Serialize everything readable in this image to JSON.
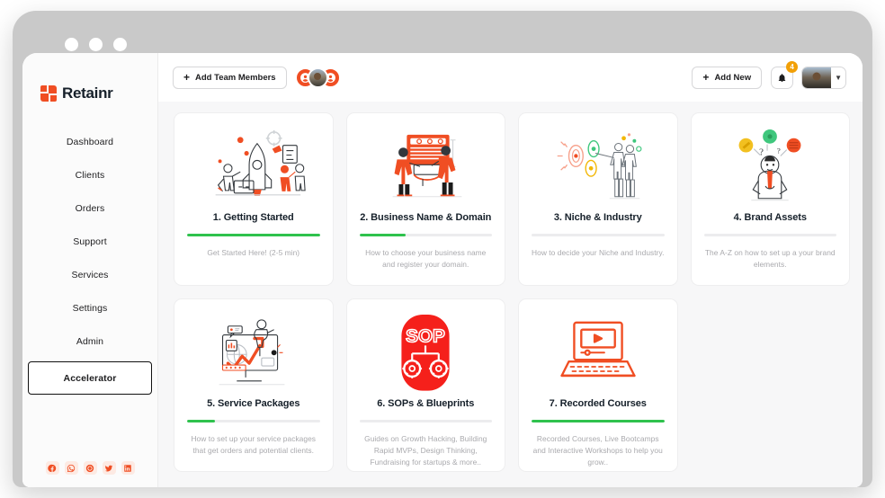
{
  "window": {
    "dots": [
      "close",
      "minimize",
      "maximize"
    ]
  },
  "sidebar": {
    "brand": "Retainr",
    "items": [
      {
        "label": "Dashboard",
        "active": false
      },
      {
        "label": "Clients",
        "active": false
      },
      {
        "label": "Orders",
        "active": false
      },
      {
        "label": "Support",
        "active": false
      },
      {
        "label": "Services",
        "active": false
      },
      {
        "label": "Settings",
        "active": false
      },
      {
        "label": "Admin",
        "active": false
      },
      {
        "label": "Accelerator",
        "active": true
      }
    ],
    "socials": [
      {
        "name": "facebook-icon"
      },
      {
        "name": "whatsapp-icon"
      },
      {
        "name": "messenger-icon"
      },
      {
        "name": "twitter-icon"
      },
      {
        "name": "linkedin-icon"
      }
    ]
  },
  "topbar": {
    "add_team_members_label": "Add Team Members",
    "add_new_label": "Add New",
    "notification_count": "4",
    "team_avatars": 3,
    "chevron": "⌄"
  },
  "colors": {
    "brand_orange": "#f04e23",
    "progress_green": "#2fc24d",
    "badge_amber": "#f2a007",
    "page_bg": "#f7f7f8",
    "card_bg": "#ffffff",
    "text_dark": "#16202a",
    "text_muted": "#a9a9ad"
  },
  "cards": [
    {
      "title": "1. Getting Started",
      "progress": 100,
      "desc": "Get Started Here! (2-5 min)",
      "art": "rocket-team-illustration"
    },
    {
      "title": "2. Business Name & Domain",
      "progress": 35,
      "desc": "How to choose your business name and register your domain.",
      "art": "two-people-board-illustration"
    },
    {
      "title": "3. Niche & Industry",
      "progress": 0,
      "desc": "How to decide your Niche and Industry.",
      "art": "couple-targets-illustration"
    },
    {
      "title": "4. Brand Assets",
      "progress": 0,
      "desc": "The A-Z on how to set up a your brand elements.",
      "art": "thinking-person-illustration"
    },
    {
      "title": "5. Service Packages",
      "progress": 21,
      "desc": "How to set up your service packages that get orders and potential clients.",
      "art": "growth-chart-illustration"
    },
    {
      "title": "6. SOPs & Blueprints",
      "progress": 0,
      "desc": "Guides on Growth Hacking, Building Rapid MVPs, Design Thinking, Fundraising for startups & more..",
      "art": "sop-gears-icon"
    },
    {
      "title": "7. Recorded Courses",
      "progress": 100,
      "desc": "Recorded Courses, Live Bootcamps and Interactive Workshops to help you grow..",
      "art": "laptop-video-icon"
    }
  ]
}
